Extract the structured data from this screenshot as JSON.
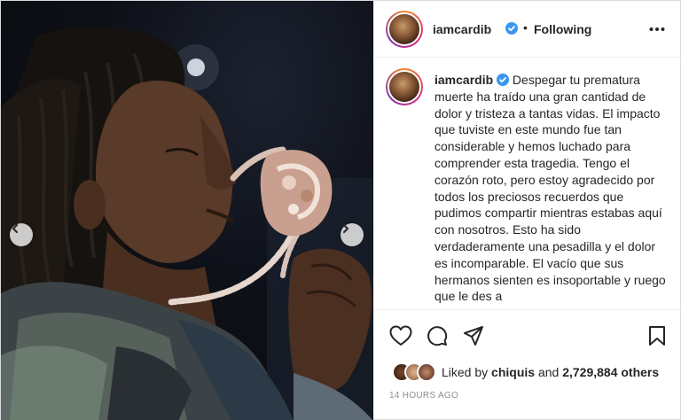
{
  "post": {
    "username": "iamcardib",
    "follow_status": "Following",
    "separator": "•",
    "caption_username": "iamcardib",
    "caption": "Despegar tu prematura muerte ha traído una gran cantidad de dolor y tristeza a tantas vidas. El impacto que tuviste en este mundo fue tan considerable y hemos luchado para comprender esta tragedia. Tengo el corazón roto, pero estoy agradecido por todos los preciosos recuerdos que pudimos compartir mientras estabas aquí con nosotros. Esto ha sido verdaderamente una pesadilla y el dolor es incomparable. El vacío que sus hermanos sienten es insoportable y ruego que le des a",
    "likes_prefix": "Liked by",
    "liked_by_user": "chiquis",
    "likes_and": "and",
    "likes_count": "2,729,884 others",
    "timestamp": "14 HOURS AGO"
  },
  "icons": {
    "verified": "verified-badge-icon",
    "more": "more-options-icon",
    "like": "heart-icon",
    "comment": "comment-icon",
    "share": "send-icon",
    "save": "bookmark-icon",
    "prev": "chevron-left-icon",
    "next": "chevron-right-icon"
  },
  "colors": {
    "verified_blue": "#3897f0",
    "text": "#262626",
    "secondary_text": "#8e8e8e",
    "border": "#efefef"
  }
}
